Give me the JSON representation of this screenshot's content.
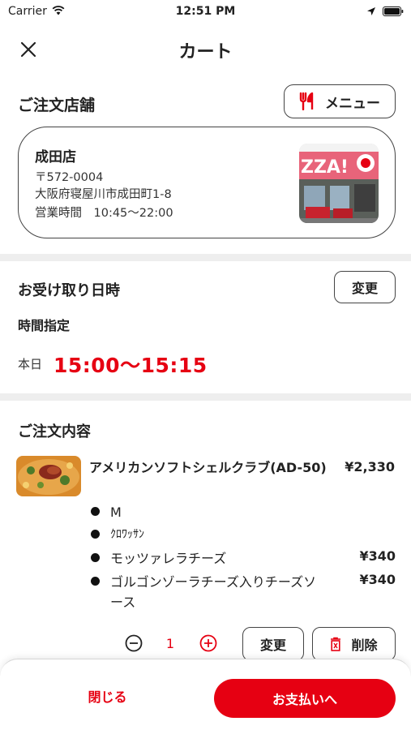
{
  "status_bar": {
    "carrier": "Carrier",
    "time": "12:51 PM"
  },
  "header": {
    "title": "カート"
  },
  "store": {
    "section_title": "ご注文店舗",
    "menu_label": "メニュー",
    "name": "成田店",
    "postal": "〒572-0004",
    "address": "大阪府寝屋川市成田町1-8",
    "hours": "営業時間　10:45～22:00",
    "photo_sign_text": "ZZA!"
  },
  "pickup": {
    "section_title": "お受け取り日時",
    "change_label": "変更",
    "mode": "時間指定",
    "day": "本日",
    "time": "15:00～15:15"
  },
  "order": {
    "section_title": "ご注文内容",
    "items": [
      {
        "name": "アメリカンソフトシェルクラブ(AD-50)",
        "price": "¥2,330",
        "options": [
          {
            "label": "M",
            "price": ""
          },
          {
            "label": "ｸﾛﾜｯｻﾝ",
            "price": ""
          },
          {
            "label": "モッツァレラチーズ",
            "price": "¥340"
          },
          {
            "label": "ゴルゴンゾーラチーズ入りチーズソース",
            "price": "¥340"
          }
        ],
        "quantity": "1",
        "change_label": "変更",
        "delete_label": "削除"
      }
    ]
  },
  "footer": {
    "close_label": "閉じる",
    "pay_label": "お支払いへ"
  },
  "colors": {
    "accent": "#e60012",
    "divider": "#eeeeee",
    "text": "#222222"
  }
}
